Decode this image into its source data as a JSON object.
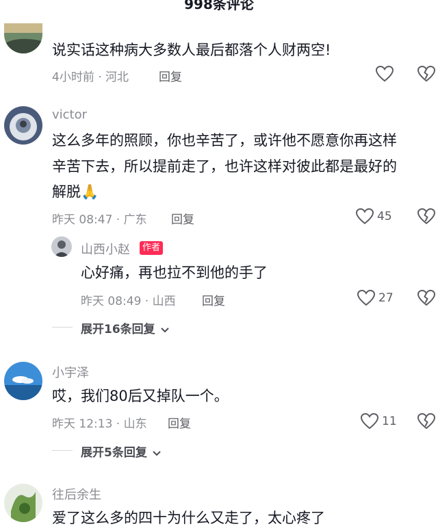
{
  "header": {
    "title": "998条评论"
  },
  "comments": [
    {
      "username": "",
      "text": "说实话这种病大多数人最后都落个人财两空!",
      "time": "4小时前 · 河北",
      "reply_label": "回复",
      "likes": ""
    },
    {
      "username": "victor",
      "text_lines": [
        "这么多年的照顾，你也辛苦了，或许他不愿意你再这样",
        "辛苦下去，所以提前走了，也许这样对彼此都是最好的",
        "解脱"
      ],
      "emoji": "🙏",
      "time": "昨天 08:47 · 广东",
      "reply_label": "回复",
      "likes": "45",
      "reply": {
        "username": "山西小赵",
        "author_tag": "作者",
        "text": "心好痛，再也拉不到他的手了",
        "time": "昨天 08:49 · 山西",
        "reply_label": "回复",
        "likes": "27"
      },
      "expand_label": "展开16条回复"
    },
    {
      "username": "小宇泽",
      "text": "哎，我们80后又掉队一个。",
      "time": "昨天 12:13 · 山东",
      "reply_label": "回复",
      "likes": "11",
      "expand_label": "展开5条回复"
    },
    {
      "username": "往后余生",
      "text": "爱了这么多的四十为什么又走了，太心疼了"
    }
  ],
  "colors": {
    "accent": "#fe2c55",
    "muted": "#8a8b91"
  },
  "icons": {
    "like": "heart-outline-icon",
    "dislike": "broken-heart-icon",
    "expand": "chevron-down-icon"
  }
}
